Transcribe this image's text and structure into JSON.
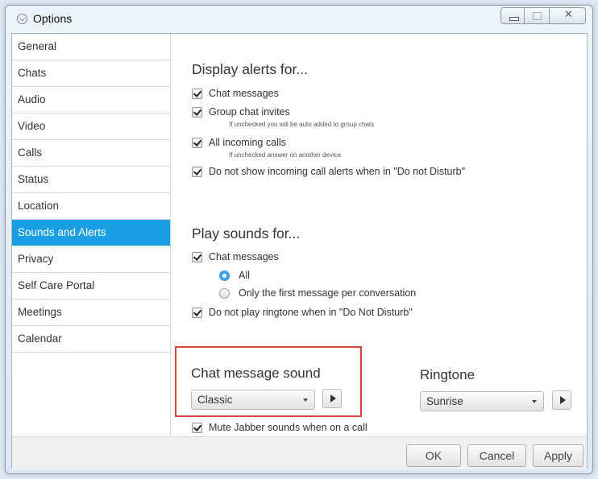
{
  "window": {
    "title": "Options",
    "icon": "app-icon"
  },
  "sidebar": {
    "items": [
      {
        "label": "General"
      },
      {
        "label": "Chats"
      },
      {
        "label": "Audio"
      },
      {
        "label": "Video"
      },
      {
        "label": "Calls"
      },
      {
        "label": "Status"
      },
      {
        "label": "Location"
      },
      {
        "label": "Sounds and Alerts",
        "active": true
      },
      {
        "label": "Privacy"
      },
      {
        "label": "Self Care Portal"
      },
      {
        "label": "Meetings"
      },
      {
        "label": "Calendar"
      }
    ]
  },
  "display_alerts": {
    "title": "Display alerts for...",
    "chat_messages": {
      "label": "Chat messages",
      "checked": true
    },
    "group_chat_invites": {
      "label": "Group chat invites",
      "checked": true,
      "hint": "If unchecked you will be auto added to group chats"
    },
    "incoming_calls": {
      "label": "All incoming calls",
      "checked": true,
      "hint": "If unchecked answer on another device"
    },
    "dnd_calls": {
      "label": "Do not show incoming call alerts when in \"Do not Disturb\"",
      "checked": true
    }
  },
  "play_sounds": {
    "title": "Play sounds for...",
    "chat_messages": {
      "label": "Chat messages",
      "checked": true
    },
    "radio_all": {
      "label": "All",
      "selected": true
    },
    "radio_first": {
      "label": "Only the first message per conversation",
      "selected": false
    },
    "dnd_ringtone": {
      "label": "Do not play ringtone when in \"Do Not Disturb\"",
      "checked": true
    }
  },
  "chat_sound": {
    "label": "Chat message sound",
    "value": "Classic"
  },
  "ringtone": {
    "label": "Ringtone",
    "value": "Sunrise"
  },
  "mute": {
    "label": "Mute Jabber sounds when on a call",
    "checked": true
  },
  "footer": {
    "ok": "OK",
    "cancel": "Cancel",
    "apply": "Apply"
  },
  "colors": {
    "accent": "#1a9ee4",
    "highlight_border": "#d9443a"
  }
}
